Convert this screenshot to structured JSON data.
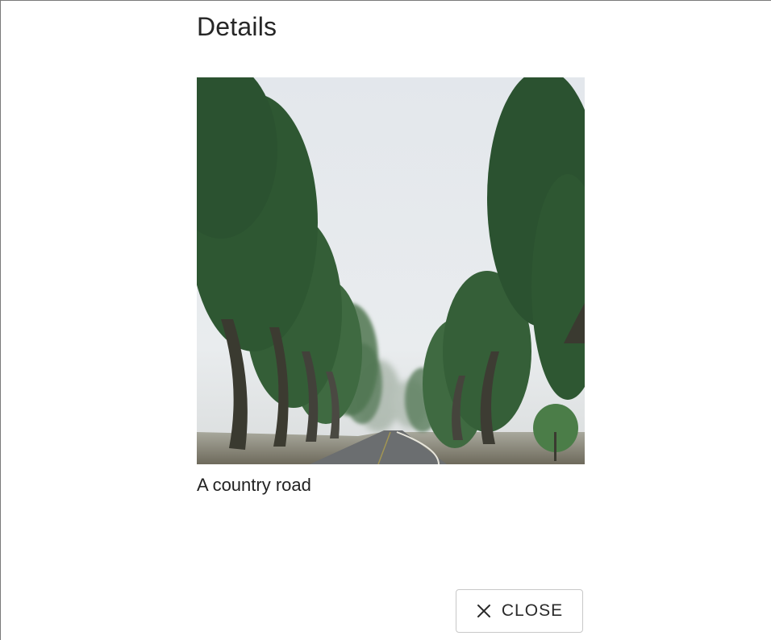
{
  "dialog": {
    "title": "Details",
    "caption": "A country road",
    "close_label": "CLOSE",
    "close_icon": "close-icon"
  },
  "image": {
    "subject": "fog-road-trees"
  },
  "colors": {
    "sky": "#e6eaee",
    "foliage_dark": "#2f5a33",
    "foliage": "#3e7040",
    "trunk": "#3a3a32",
    "road": "#6d6f70"
  }
}
